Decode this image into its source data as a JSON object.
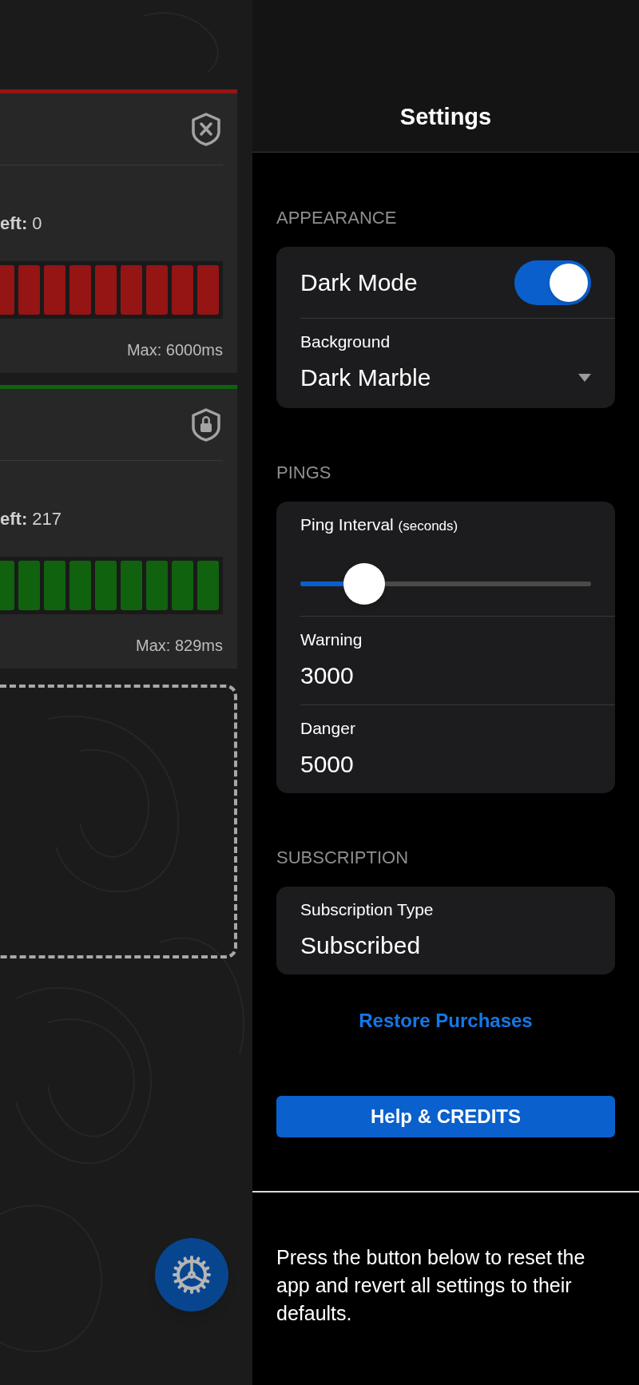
{
  "monitors": [
    {
      "label": "**eft:** 0",
      "max": "Max: 6000ms",
      "color": "#951414",
      "locked": false
    },
    {
      "label": "**eft:** 217",
      "max": "Max: 829ms",
      "color": "#10620f",
      "locked": true
    }
  ],
  "settings": {
    "title": "Settings",
    "sections": [
      {
        "heading": "APPEARANCE",
        "rows": [
          {
            "kind": "toggle",
            "label": "Dark Mode",
            "on": true
          },
          {
            "kind": "dropdown",
            "label": "Background",
            "value": "Dark Marble"
          }
        ]
      },
      {
        "heading": "PINGS",
        "rows": [
          {
            "kind": "slider",
            "label": "Ping Interval",
            "hint": "(seconds)",
            "level": 0.22
          },
          {
            "kind": "field",
            "label": "Warning",
            "value": "3000"
          },
          {
            "kind": "field",
            "label": "Danger",
            "value": "5000"
          }
        ]
      },
      {
        "heading": "SUBSCRIPTION",
        "rows": [
          {
            "kind": "info",
            "label": "Subscription Type",
            "value": "Subscribed"
          }
        ]
      }
    ],
    "restore_link": "Restore Purchases",
    "help_button": "Help & CREDITS",
    "reset_note": "Press the button below to reset the app and revert all settings to their defaults."
  }
}
